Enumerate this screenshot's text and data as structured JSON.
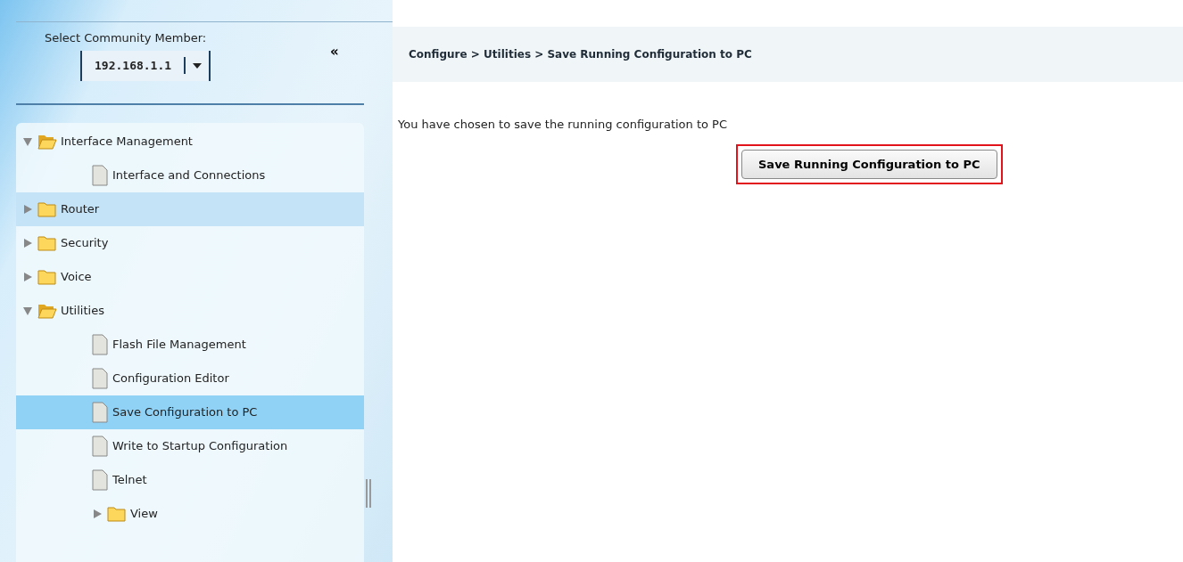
{
  "sidebar": {
    "member_label": "Select Community Member:",
    "member_select": {
      "value": "192.168.1.1"
    },
    "collapse_button": "«",
    "tree": [
      {
        "label": "Interface Management",
        "kind": "folder",
        "expanded": true,
        "selected": false,
        "hovered": false,
        "children": [
          {
            "label": "Interface and Connections",
            "kind": "page",
            "selected": false,
            "hovered": false
          }
        ]
      },
      {
        "label": "Router",
        "kind": "folder",
        "expanded": false,
        "selected": false,
        "hovered": true
      },
      {
        "label": "Security",
        "kind": "folder",
        "expanded": false,
        "selected": false,
        "hovered": false
      },
      {
        "label": "Voice",
        "kind": "folder",
        "expanded": false,
        "selected": false,
        "hovered": false
      },
      {
        "label": "Utilities",
        "kind": "folder",
        "expanded": true,
        "selected": false,
        "hovered": false,
        "children": [
          {
            "label": "Flash File Management",
            "kind": "page",
            "selected": false,
            "hovered": false
          },
          {
            "label": "Configuration Editor",
            "kind": "page",
            "selected": false,
            "hovered": false
          },
          {
            "label": "Save Configuration to PC",
            "kind": "page",
            "selected": true,
            "hovered": false
          },
          {
            "label": "Write to Startup Configuration",
            "kind": "page",
            "selected": false,
            "hovered": false
          },
          {
            "label": "Telnet",
            "kind": "page",
            "selected": false,
            "hovered": false
          },
          {
            "label": "View",
            "kind": "folder",
            "expanded": false,
            "selected": false,
            "hovered": false
          }
        ]
      }
    ]
  },
  "breadcrumb": "Configure > Utilities > Save Running Configuration to PC",
  "content": {
    "message": "You have chosen to save the running configuration to PC",
    "button": {
      "label": "Save Running Configuration to PC",
      "highlighted": true
    }
  }
}
